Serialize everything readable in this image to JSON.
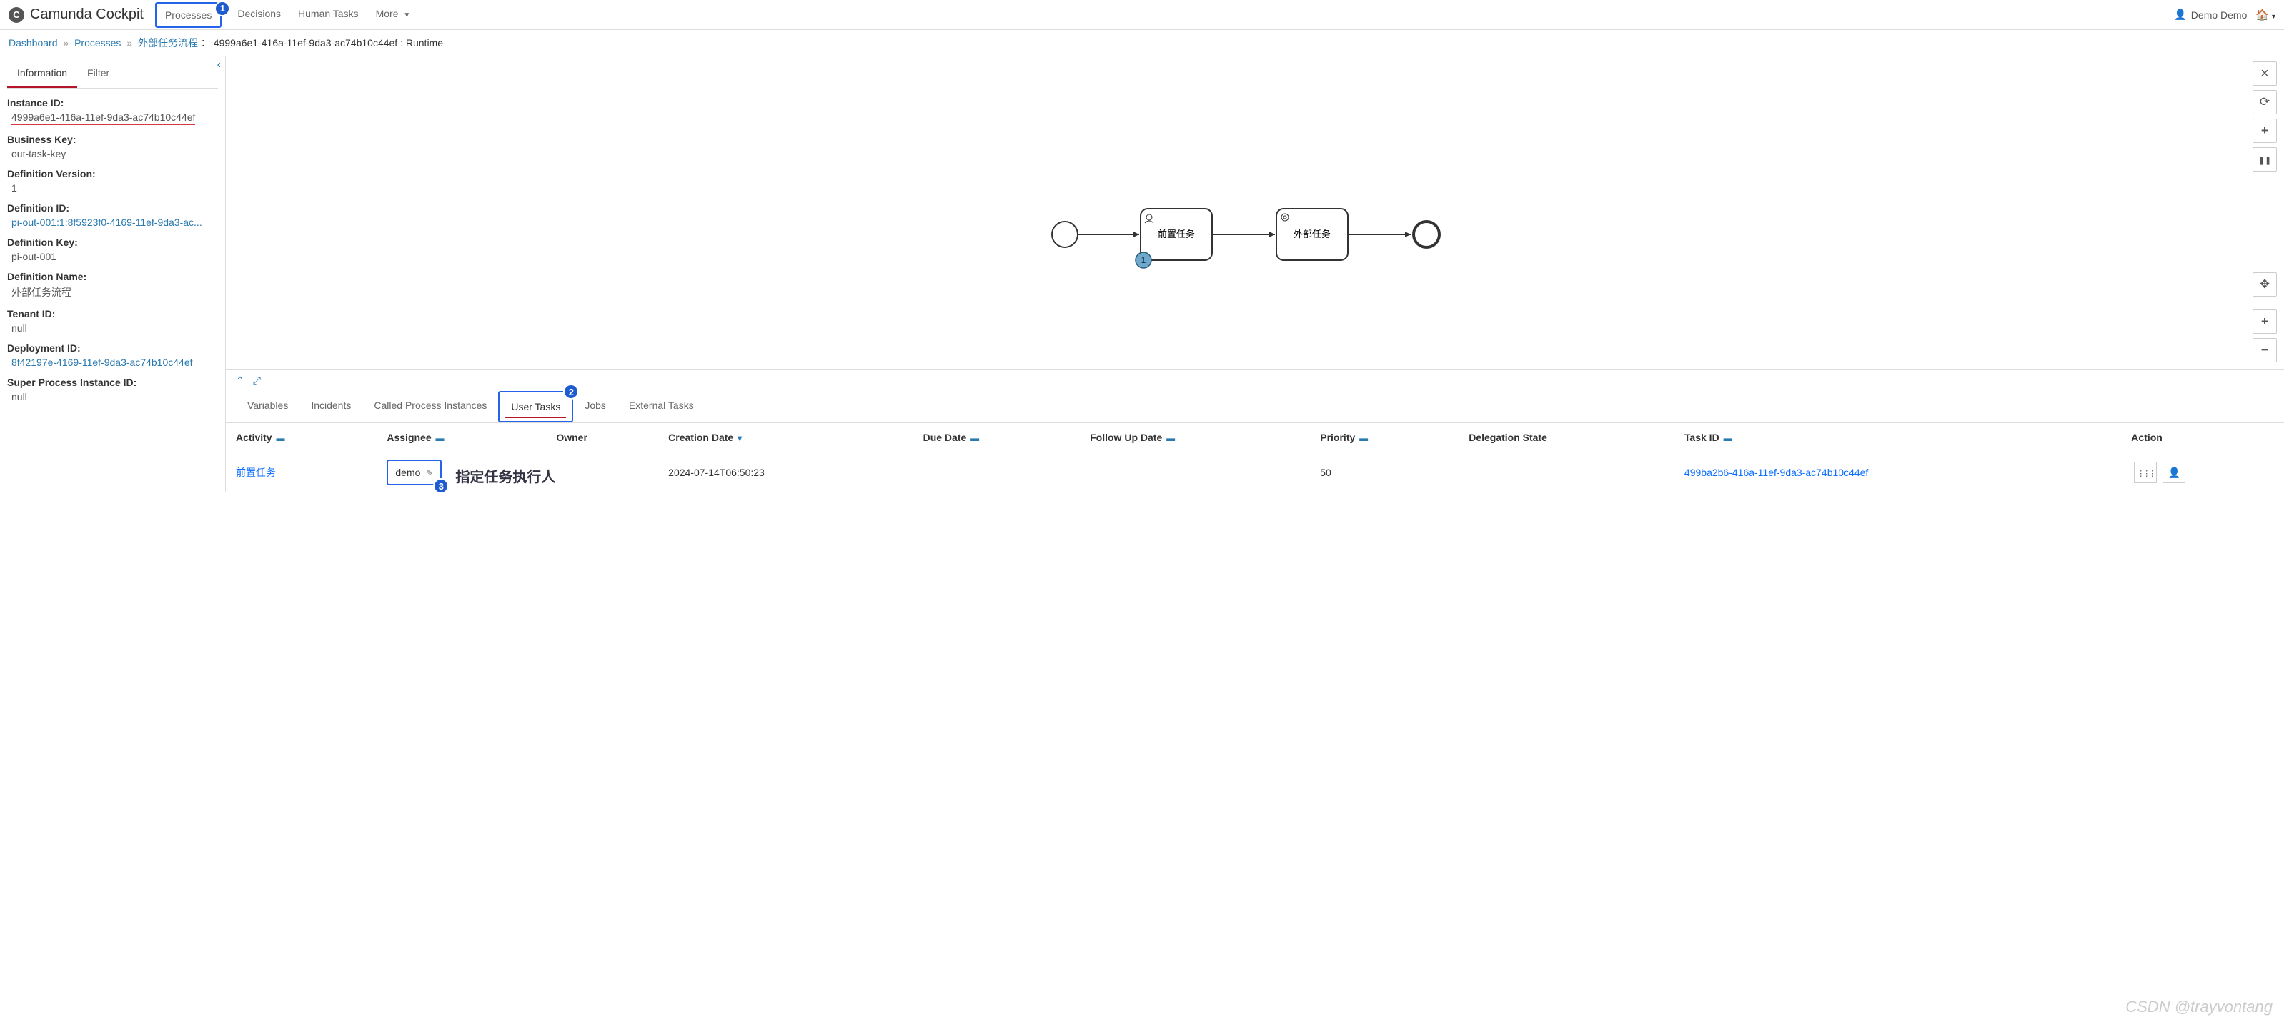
{
  "header": {
    "app_title": "Camunda Cockpit",
    "nav": [
      "Processes",
      "Decisions",
      "Human Tasks",
      "More"
    ],
    "user_name": "Demo Demo"
  },
  "breadcrumb": {
    "dashboard": "Dashboard",
    "processes": "Processes",
    "process_name": "外部任务流程",
    "instance_id": "4999a6e1-416a-11ef-9da3-ac74b10c44ef",
    "suffix": "Runtime"
  },
  "sidebar": {
    "tabs": {
      "information": "Information",
      "filter": "Filter"
    },
    "items": {
      "instance_id": {
        "label": "Instance ID:",
        "value": "4999a6e1-416a-11ef-9da3-ac74b10c44ef"
      },
      "business_key": {
        "label": "Business Key:",
        "value": "out-task-key"
      },
      "definition_version": {
        "label": "Definition Version:",
        "value": "1"
      },
      "definition_id": {
        "label": "Definition ID:",
        "value": "pi-out-001:1:8f5923f0-4169-11ef-9da3-ac..."
      },
      "definition_key": {
        "label": "Definition Key:",
        "value": "pi-out-001"
      },
      "definition_name": {
        "label": "Definition Name:",
        "value": "外部任务流程"
      },
      "tenant_id": {
        "label": "Tenant ID:",
        "value": "null"
      },
      "deployment_id": {
        "label": "Deployment ID:",
        "value": "8f42197e-4169-11ef-9da3-ac74b10c44ef"
      },
      "super_instance_id": {
        "label": "Super Process Instance ID:",
        "value": "null"
      }
    }
  },
  "diagram": {
    "task1_label": "前置任务",
    "task2_label": "外部任务",
    "badge": "1"
  },
  "bottom_tabs": [
    "Variables",
    "Incidents",
    "Called Process Instances",
    "User Tasks",
    "Jobs",
    "External Tasks"
  ],
  "table": {
    "headers": {
      "activity": "Activity",
      "assignee": "Assignee",
      "owner": "Owner",
      "creation_date": "Creation Date",
      "due_date": "Due Date",
      "follow_up": "Follow Up Date",
      "priority": "Priority",
      "delegation": "Delegation State",
      "task_id": "Task ID",
      "action": "Action"
    },
    "row": {
      "activity": "前置任务",
      "assignee": "demo",
      "owner": "",
      "creation_date": "2024-07-14T06:50:23",
      "due_date": "",
      "follow_up": "",
      "priority": "50",
      "delegation": "",
      "task_id": "499ba2b6-416a-11ef-9da3-ac74b10c44ef"
    }
  },
  "annotation": "指定任务执行人",
  "watermark": "CSDN @trayvontang",
  "callouts": {
    "c1": "1",
    "c2": "2",
    "c3": "3"
  }
}
